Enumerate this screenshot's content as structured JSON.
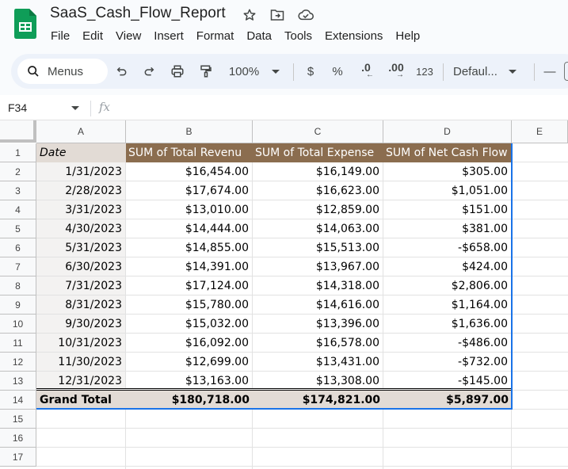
{
  "app": {
    "doc_title": "SaaS_Cash_Flow_Report",
    "title_icons": [
      "star-icon",
      "move-to-folder-icon",
      "cloud-saved-icon"
    ],
    "menu": [
      "File",
      "Edit",
      "View",
      "Insert",
      "Format",
      "Data",
      "Tools",
      "Extensions",
      "Help"
    ],
    "brand_color": "#0f9d58"
  },
  "toolbar": {
    "search_label": "Menus",
    "zoom": "100%",
    "currency": "$",
    "percent": "%",
    "decrease_decimal": ".0",
    "increase_decimal": ".00",
    "number_format": "123",
    "font": "Defaul...",
    "font_size_minus": "—"
  },
  "formula_bar": {
    "cell_ref": "F34",
    "fx": "fx",
    "value": ""
  },
  "sheet": {
    "columns": [
      "A",
      "B",
      "C",
      "D",
      "E"
    ],
    "row_numbers": [
      "1",
      "2",
      "3",
      "4",
      "5",
      "6",
      "7",
      "8",
      "9",
      "10",
      "11",
      "12",
      "13",
      "14",
      "15",
      "16",
      "17"
    ],
    "header": [
      "Date",
      "SUM of Total Revenu",
      "SUM of Total Expense",
      "SUM of Net Cash Flow"
    ],
    "rows": [
      [
        "1/31/2023",
        "$16,454.00",
        "$16,149.00",
        "$305.00"
      ],
      [
        "2/28/2023",
        "$17,674.00",
        "$16,623.00",
        "$1,051.00"
      ],
      [
        "3/31/2023",
        "$13,010.00",
        "$12,859.00",
        "$151.00"
      ],
      [
        "4/30/2023",
        "$14,444.00",
        "$14,063.00",
        "$381.00"
      ],
      [
        "5/31/2023",
        "$14,855.00",
        "$15,513.00",
        "-$658.00"
      ],
      [
        "6/30/2023",
        "$14,391.00",
        "$13,967.00",
        "$424.00"
      ],
      [
        "7/31/2023",
        "$17,124.00",
        "$14,318.00",
        "$2,806.00"
      ],
      [
        "8/31/2023",
        "$15,780.00",
        "$14,616.00",
        "$1,164.00"
      ],
      [
        "9/30/2023",
        "$15,032.00",
        "$13,396.00",
        "$1,636.00"
      ],
      [
        "10/31/2023",
        "$16,092.00",
        "$16,578.00",
        "-$486.00"
      ],
      [
        "11/30/2023",
        "$12,699.00",
        "$13,431.00",
        "-$732.00"
      ],
      [
        "12/31/2023",
        "$13,163.00",
        "$13,308.00",
        "-$145.00"
      ]
    ],
    "total": [
      "Grand Total",
      "$180,718.00",
      "$174,821.00",
      "$5,897.00"
    ],
    "colors": {
      "header_bg": "#8b6d4f",
      "header_date_bg": "#e2dbd5",
      "date_col_bg": "#f3f2f1",
      "total_bg": "#e2dbd5",
      "selection_border": "#1a73e8"
    }
  }
}
